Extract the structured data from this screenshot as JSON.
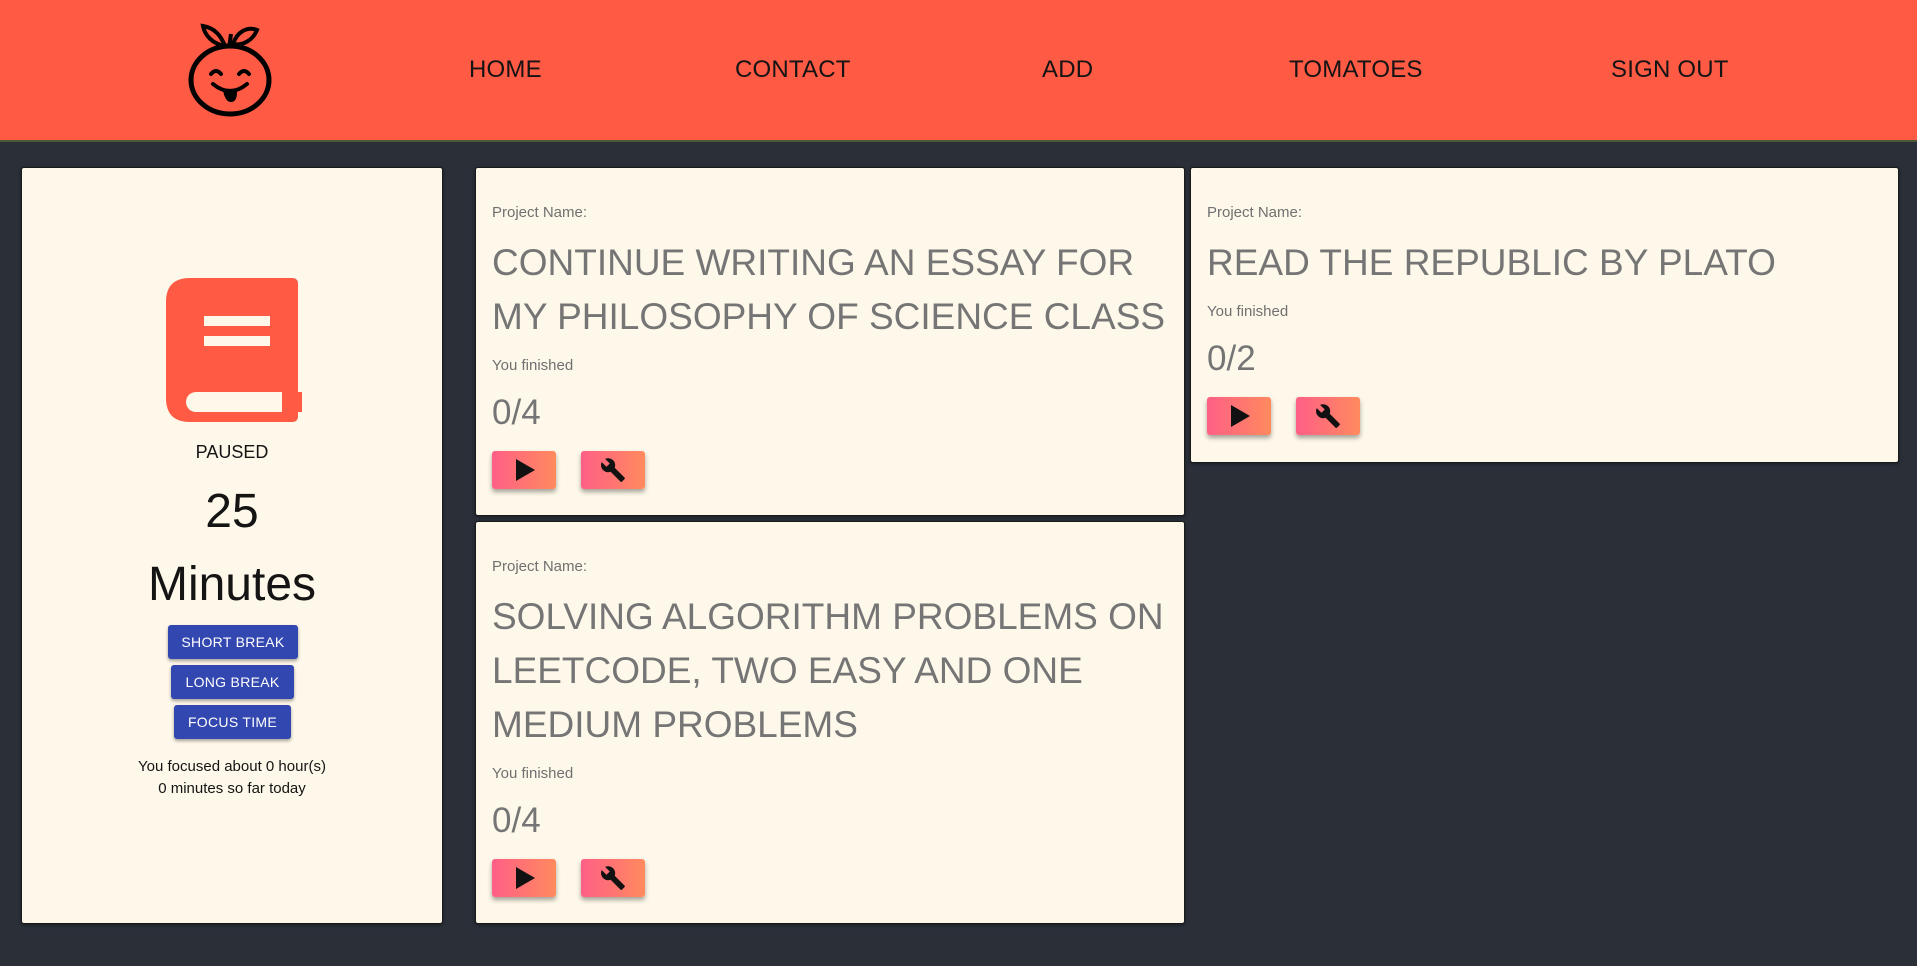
{
  "nav": {
    "items": [
      {
        "label": "HOME"
      },
      {
        "label": "CONTACT"
      },
      {
        "label": "ADD"
      },
      {
        "label": "TOMATOES"
      },
      {
        "label": "SIGN OUT"
      }
    ]
  },
  "timer": {
    "icon": "book-icon",
    "status": "PAUSED",
    "minutes_value": "25",
    "minutes_label": "Minutes",
    "buttons": [
      "SHORT BREAK",
      "LONG BREAK",
      "FOCUS TIME"
    ],
    "summary_line1": "You focused about 0 hour(s)",
    "summary_line2": "0 minutes so far today"
  },
  "projects": [
    {
      "label": "Project Name:",
      "name": "CONTINUE WRITING AN ESSAY FOR MY PHILOSOPHY OF SCIENCE CLASS",
      "finished_label": "You finished",
      "progress": "0/4"
    },
    {
      "label": "Project Name:",
      "name": "READ THE REPUBLIC BY PLATO",
      "finished_label": "You finished",
      "progress": "0/2"
    },
    {
      "label": "Project Name:",
      "name": "SOLVING ALGORITHM PROBLEMS ON LEETCODE, TWO EASY AND ONE MEDIUM PROBLEMS",
      "finished_label": "You finished",
      "progress": "0/4"
    }
  ],
  "icons": {
    "logo": "tomato-face-logo",
    "play": "play-icon",
    "settings": "wrench-icon"
  },
  "colors": {
    "navbar": "#ff5a44",
    "page_background": "#2a2f38",
    "card_background": "#fef8ea",
    "mode_button": "#3347b0",
    "action_gradient_start": "#ff5f86",
    "action_gradient_end": "#ff8a5e",
    "book_icon": "#ff5a44"
  }
}
